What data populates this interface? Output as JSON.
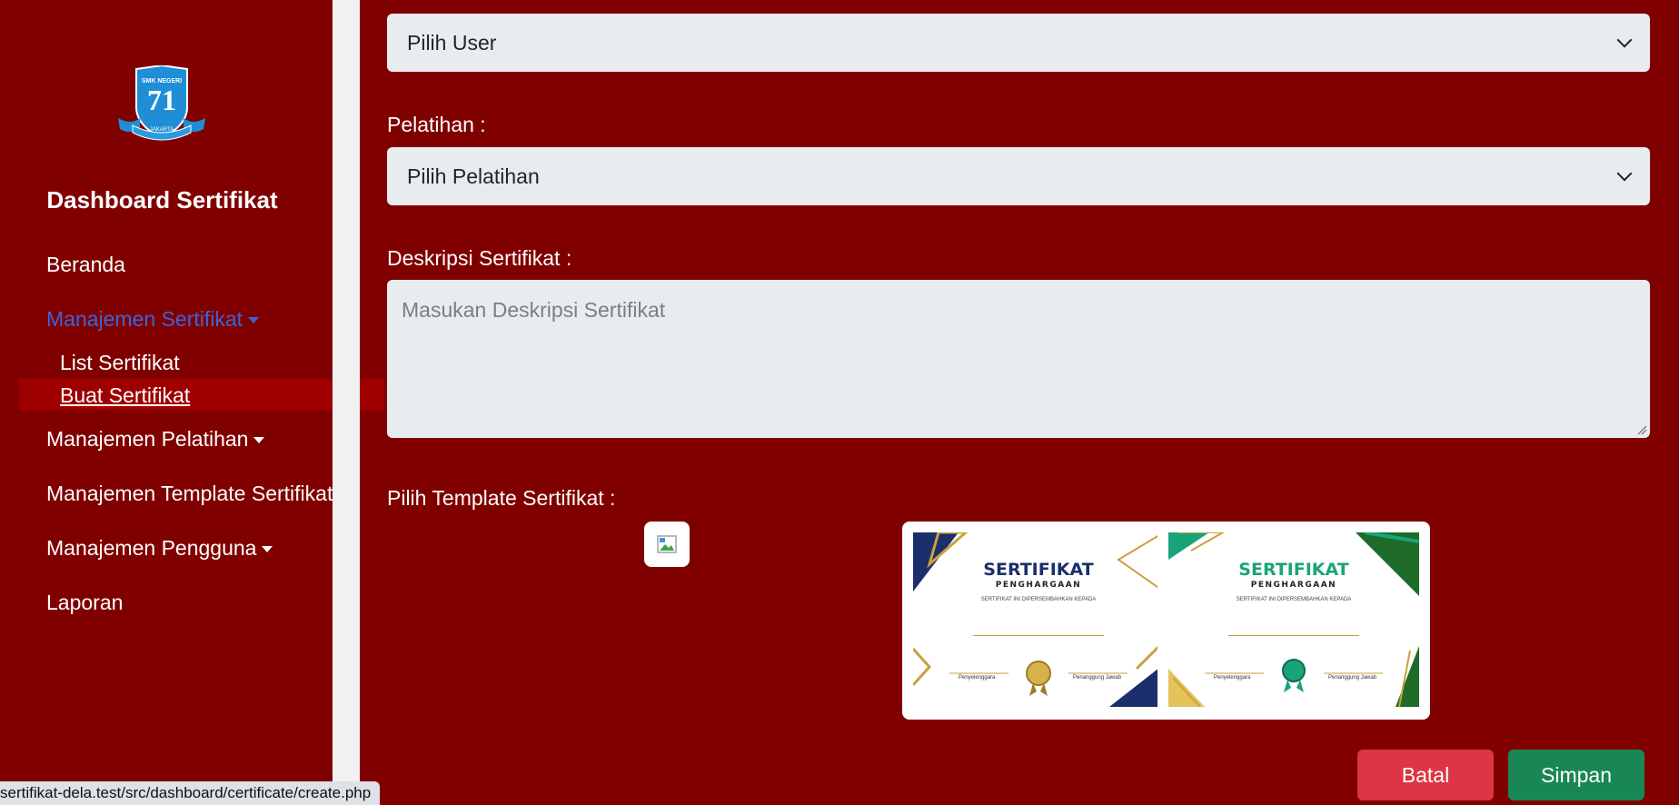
{
  "sidebar": {
    "logo": {
      "line1": "SMK NEGERI",
      "number": "71",
      "line2": "JAKARTA"
    },
    "brand": "Dashboard Sertifikat",
    "menu": [
      {
        "label": "Beranda"
      },
      {
        "label": "Manajemen Sertifikat"
      },
      {
        "label": "Manajemen Pelatihan"
      },
      {
        "label": "Manajemen Template Sertifikat"
      },
      {
        "label": "Manajemen Pengguna"
      },
      {
        "label": "Laporan"
      }
    ],
    "submenu": [
      {
        "label": "List Sertifikat"
      },
      {
        "label": "Buat Sertifikat"
      }
    ]
  },
  "form": {
    "user_select": {
      "value": "Pilih User"
    },
    "pelatihan": {
      "label": "Pelatihan :",
      "value": "Pilih Pelatihan"
    },
    "deskripsi": {
      "label": "Deskripsi Sertifikat :",
      "placeholder": "Masukan Deskripsi Sertifikat"
    },
    "template": {
      "label": "Pilih Template Sertifikat :"
    }
  },
  "templates": [
    {
      "title": "SERTIFIKAT",
      "subtitle": "PENGHARGAAN",
      "text": "SERTIFIKAT INI DIPERSEMBAHKAN KEPADA",
      "sign_left": "Penyelenggara",
      "sign_right": "Penanggung Jawab",
      "accent": "#1a2f6b",
      "secondary": "#c9a23a"
    },
    {
      "title": "SERTIFIKAT",
      "subtitle": "PENGHARGAAN",
      "text": "SERTIFIKAT INI DIPERSEMBAHKAN KEPADA",
      "sign_left": "Penyelenggara",
      "sign_right": "Penanggung Jawab",
      "accent": "#1aa37a",
      "secondary": "#c9a23a"
    }
  ],
  "buttons": {
    "cancel": "Batal",
    "save": "Simpan"
  },
  "statusbar": {
    "url": "sertifikat-dela.test/src/dashboard/certificate/create.php"
  },
  "colors": {
    "background": "#800000",
    "active_link": "#3d63d6",
    "cancel": "#dc3545",
    "save": "#198754"
  }
}
